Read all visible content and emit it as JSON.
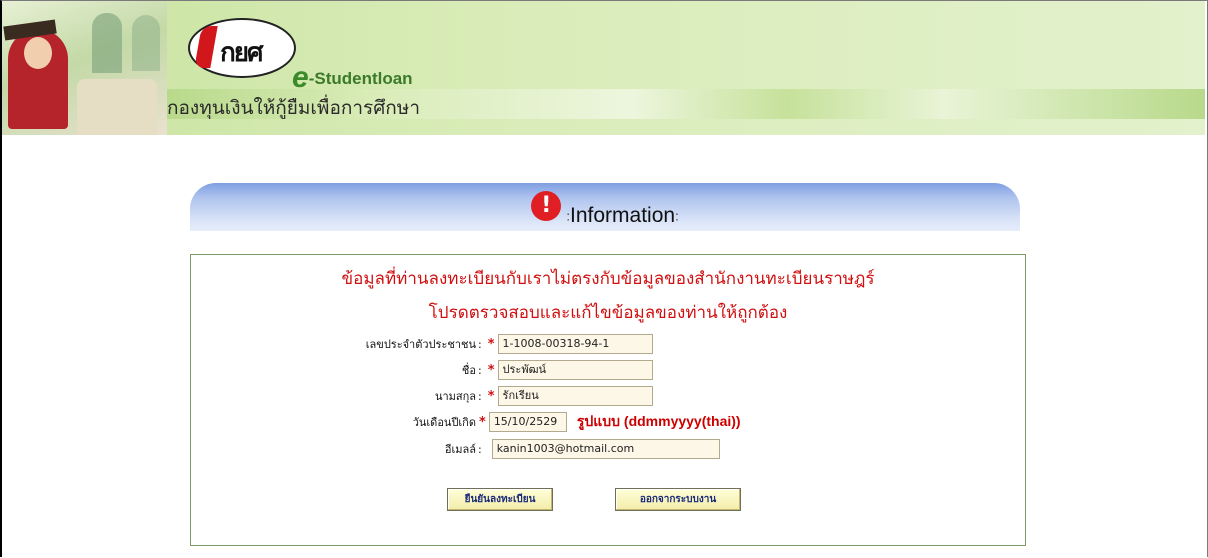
{
  "header": {
    "logo_text": "กยศ",
    "brand_prefix": "e",
    "brand_name": "-Studentloan",
    "thai_title": "กองทุนเงินให้กู้ยืมเพื่อการศึกษา"
  },
  "info": {
    "title": "Information",
    "title_colon_left": ":",
    "title_colon_right": ":",
    "alert_glyph": "!"
  },
  "message": {
    "line1": "ข้อมูลที่ท่านลงทะเบียนกับเราไม่ตรงกับข้อมูลของสำนักงานทะเบียนราษฎร์",
    "line2": "โปรดตรวจสอบและแก้ไขข้อมูลของท่านให้ถูกต้อง"
  },
  "form": {
    "id_label": "เลขประจำตัวประชาชน",
    "id_value": "1-1008-00318-94-1",
    "name_label": "ชื่อ",
    "name_value": "ประพัฒน์",
    "surname_label": "นามสกุล",
    "surname_value": "รักเรียน",
    "birth_label": "วันเดือนปีเกิด",
    "birth_value": "15/10/2529",
    "birth_format": "รูปแบบ (ddmmyyyy(thai))",
    "email_label": "อีเมลล์",
    "email_value": "kanin1003@hotmail.com",
    "required_mark": "*",
    "colon": ":"
  },
  "buttons": {
    "confirm": "ยืนยันลงทะเบียน",
    "logout": "ออกจากระบบงาน"
  },
  "colors": {
    "error_red": "#d01010",
    "header_blue": "#7f9fe1",
    "banner_green": "#c9e3a0"
  }
}
